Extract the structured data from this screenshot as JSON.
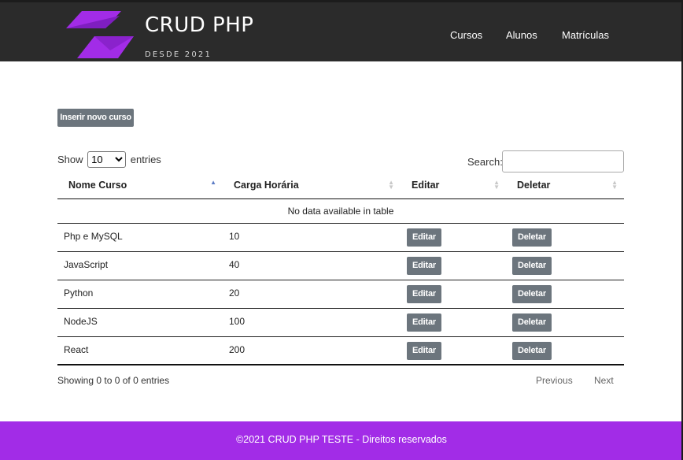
{
  "header": {
    "brand_title": "CRUD PHP",
    "brand_subtitle": "DESDE 2021",
    "nav": [
      "Cursos",
      "Alunos",
      "Matrículas"
    ]
  },
  "actions": {
    "insert_label": "Inserir novo curso"
  },
  "table_controls": {
    "show_label": "Show",
    "length_value": "10",
    "entries_label": "entries",
    "search_label": "Search:"
  },
  "table": {
    "headers": [
      "Nome Curso",
      "Carga Horária",
      "Editar",
      "Deletar"
    ],
    "empty_message": "No data available in table",
    "rows": [
      {
        "nome": "Php e MySQL",
        "carga": "10"
      },
      {
        "nome": "JavaScript",
        "carga": "40"
      },
      {
        "nome": "Python",
        "carga": "20"
      },
      {
        "nome": "NodeJS",
        "carga": "100"
      },
      {
        "nome": "React",
        "carga": "200"
      }
    ],
    "edit_label": "Editar",
    "delete_label": "Deletar"
  },
  "pagination": {
    "info": "Showing 0 to 0 of 0 entries",
    "previous": "Previous",
    "next": "Next"
  },
  "footer": {
    "text": "©2021 CRUD PHP TESTE - Direitos reservados"
  },
  "colors": {
    "header_bg": "#2b2b2b",
    "brand_accent": "#a22ce7",
    "button_gray": "#6c757d"
  }
}
